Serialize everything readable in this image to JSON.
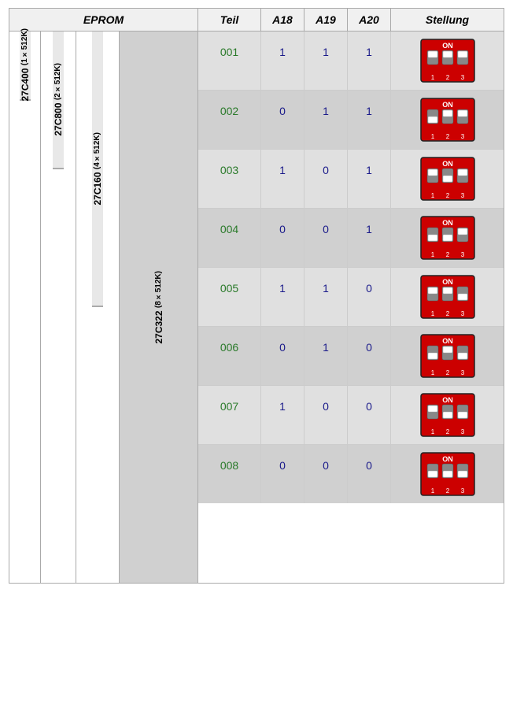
{
  "header": {
    "eprom": "EPROM",
    "teil": "Teil",
    "a18": "A18",
    "a19": "A19",
    "a20": "A20",
    "stellung": "Stellung"
  },
  "eprom_types": {
    "e1": {
      "name": "27C400",
      "sub": "(1×512K)"
    },
    "e2": {
      "name": "27C800",
      "sub": "(2×512K)"
    },
    "e3": {
      "name": "27C160",
      "sub": "(4×512K)"
    },
    "e4": {
      "name": "27C322",
      "sub": "(8×512K)"
    }
  },
  "rows": [
    {
      "teil": "001",
      "a18": "1",
      "a19": "1",
      "a20": "1"
    },
    {
      "teil": "002",
      "a18": "0",
      "a19": "1",
      "a20": "1"
    },
    {
      "teil": "003",
      "a18": "1",
      "a19": "0",
      "a20": "1"
    },
    {
      "teil": "004",
      "a18": "0",
      "a19": "0",
      "a20": "1"
    },
    {
      "teil": "005",
      "a18": "1",
      "a19": "1",
      "a20": "0"
    },
    {
      "teil": "006",
      "a18": "0",
      "a19": "1",
      "a20": "0"
    },
    {
      "teil": "007",
      "a18": "1",
      "a19": "0",
      "a20": "0"
    },
    {
      "teil": "008",
      "a18": "0",
      "a19": "0",
      "a20": "0"
    }
  ]
}
